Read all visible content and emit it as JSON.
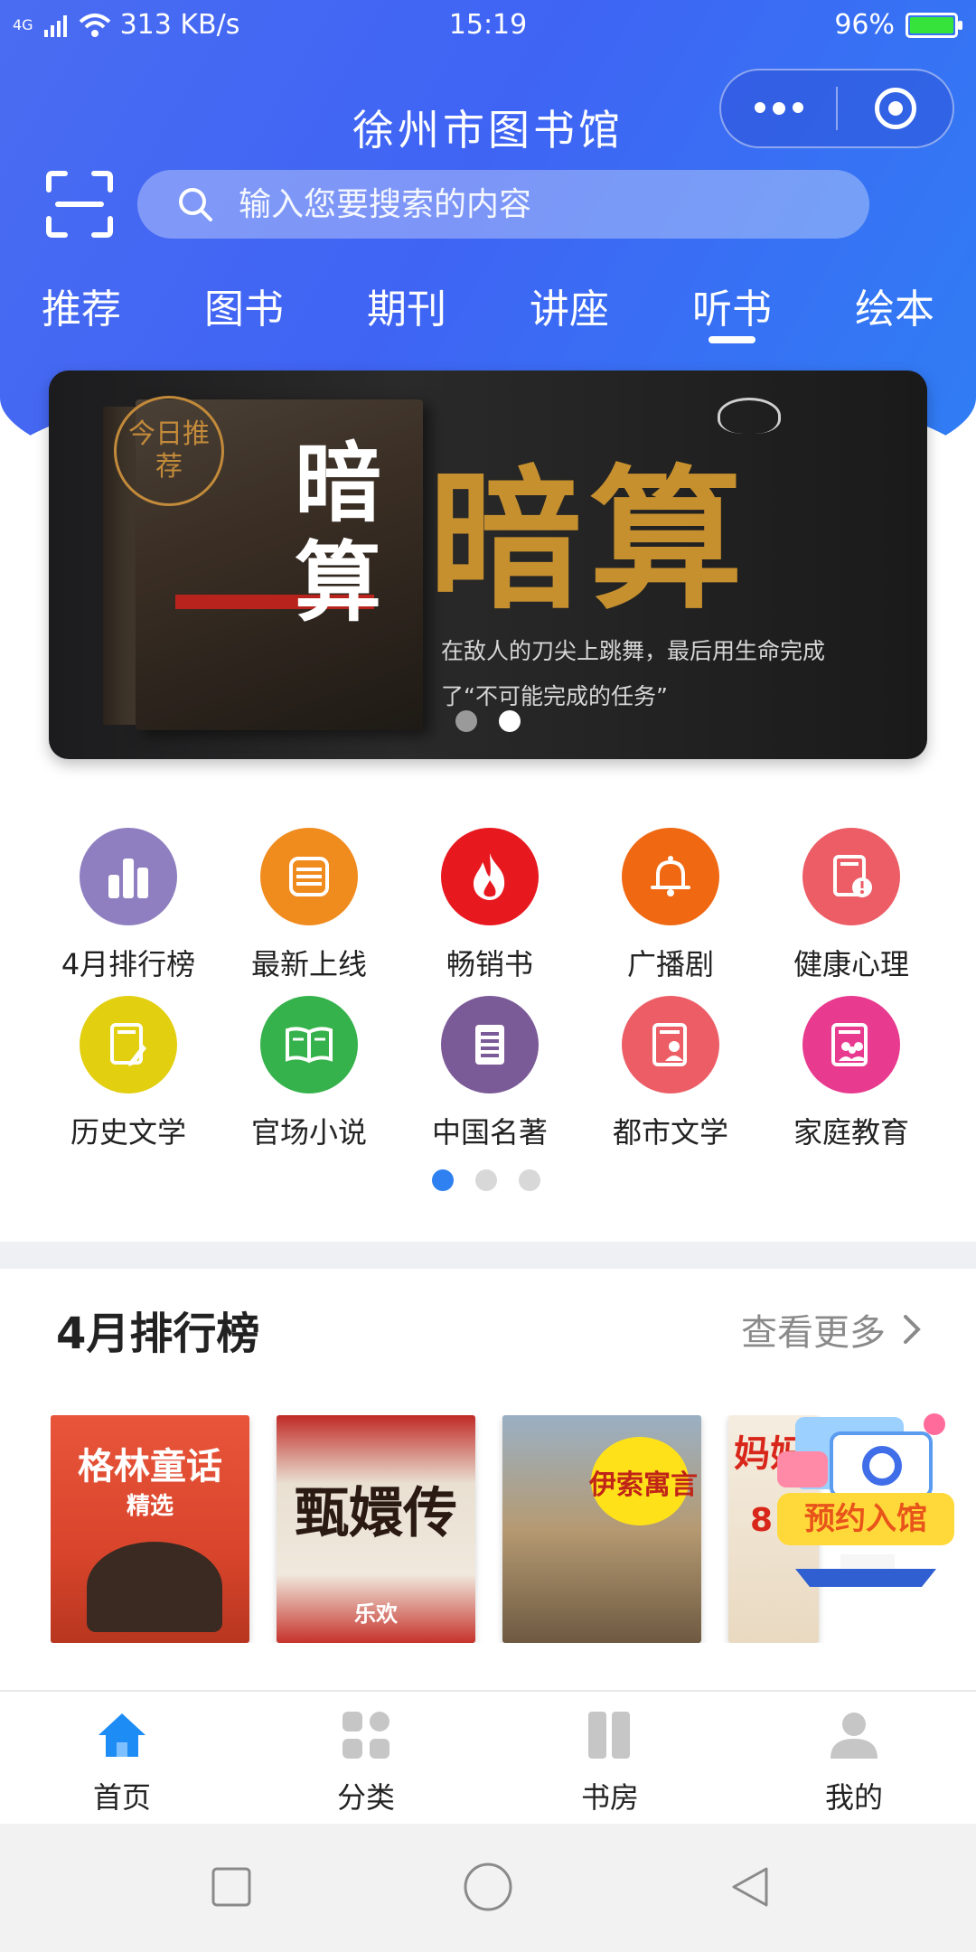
{
  "status_bar": {
    "network": "4G",
    "speed": "313 KB/s",
    "time": "15:19",
    "battery": "96%",
    "battery_color": "#36e33a"
  },
  "header": {
    "title": "徐州市图书馆",
    "search_placeholder": "输入您要搜索的内容",
    "tabs": [
      {
        "label": "推荐"
      },
      {
        "label": "图书"
      },
      {
        "label": "期刊"
      },
      {
        "label": "讲座"
      },
      {
        "label": "听书",
        "active": true
      },
      {
        "label": "绘本"
      }
    ],
    "accent": "#3f64f4"
  },
  "banner": {
    "seal_text": "今日推荐",
    "cover_title": "暗算",
    "title": "暗算",
    "description": "在敌人的刀尖上跳舞，最后用生命完成了“不可能完成的任务”",
    "page_count": 2,
    "active_page": 2
  },
  "categories": [
    {
      "label": "4月排行榜",
      "color": "#8f7fc0",
      "icon": "bar-chart-icon"
    },
    {
      "label": "最新上线",
      "color": "#f08b1d",
      "icon": "list-stack-icon"
    },
    {
      "label": "畅销书",
      "color": "#e8181f",
      "icon": "fire-icon"
    },
    {
      "label": "广播剧",
      "color": "#f06812",
      "icon": "bell-icon"
    },
    {
      "label": "健康心理",
      "color": "#ec5d66",
      "icon": "book-alert-icon"
    },
    {
      "label": "历史文学",
      "color": "#e2cf10",
      "icon": "book-pen-icon"
    },
    {
      "label": "官场小说",
      "color": "#35b24b",
      "icon": "open-book-icon"
    },
    {
      "label": "中国名著",
      "color": "#7b5a98",
      "icon": "document-icon"
    },
    {
      "label": "都市文学",
      "color": "#ec5d66",
      "icon": "book-person-icon"
    },
    {
      "label": "家庭教育",
      "color": "#e83a8f",
      "icon": "book-family-icon"
    }
  ],
  "grid_pages": 3,
  "ranking": {
    "title": "4月排行榜",
    "more_label": "查看更多",
    "books": [
      {
        "title": "格林童话",
        "subtitle": "精选"
      },
      {
        "title": "甄嬛传",
        "subtitle": "乐欢"
      },
      {
        "title": "伊索寓言",
        "subtitle": ""
      },
      {
        "title": "妈妈",
        "subtitle": "8"
      }
    ],
    "reserve_label": "预约入馆"
  },
  "bottom_nav": [
    {
      "label": "首页",
      "icon": "home-icon",
      "active": true
    },
    {
      "label": "分类",
      "icon": "grid-icon"
    },
    {
      "label": "书房",
      "icon": "bookshelf-icon"
    },
    {
      "label": "我的",
      "icon": "user-icon"
    }
  ]
}
